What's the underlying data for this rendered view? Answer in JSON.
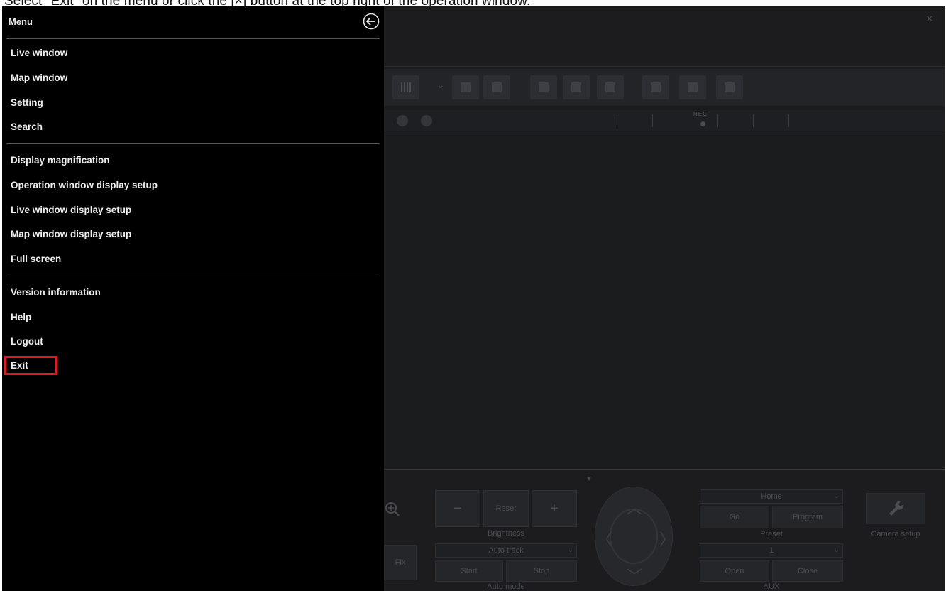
{
  "instruction_caption": "Select \"Exit\" on the menu or click the [×] button at the top right of the operation window.",
  "menu": {
    "title": "Menu",
    "group1": [
      "Live window",
      "Map window",
      "Setting",
      "Search"
    ],
    "group2": [
      "Display magnification",
      "Operation window display setup",
      "Live window display setup",
      "Map window display setup",
      "Full screen"
    ],
    "group3": [
      "Version information",
      "Help",
      "Logout",
      "Exit"
    ],
    "highlighted_item": "Exit",
    "highlight_color": "#e0192a"
  },
  "background_window": {
    "close_symbol": "×",
    "status": {
      "rec_label": "REC"
    },
    "control_panel": {
      "fix_button": "Fix",
      "brightness": {
        "minus": "−",
        "reset": "Reset",
        "plus": "+",
        "label": "Brightness"
      },
      "auto": {
        "select_value": "Auto track",
        "start": "Start",
        "stop": "Stop",
        "label": "Auto mode"
      },
      "preset": {
        "select_value": "Home",
        "go": "Go",
        "program": "Program",
        "label": "Preset"
      },
      "aux": {
        "select_value": "1",
        "open": "Open",
        "close": "Close",
        "label": "AUX"
      },
      "camera_setup_label": "Camera setup"
    }
  },
  "icons": [
    "back-arrow-icon",
    "close-icon",
    "zoom-in-icon",
    "wrench-icon",
    "chevron-down-icon"
  ]
}
